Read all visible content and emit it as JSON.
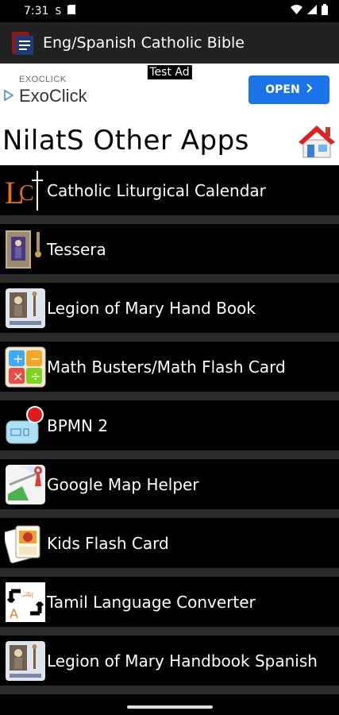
{
  "status_bar": {
    "time": "7:31",
    "icons": [
      "s-icon",
      "sim-card-icon",
      "wifi-icon",
      "signal-icon",
      "battery-icon"
    ]
  },
  "app_bar": {
    "title": "Eng/Spanish Catholic Bible"
  },
  "ad": {
    "badge": "Test Ad",
    "brand_small": "EXOCLICK",
    "brand_big": "ExoClick",
    "cta": "OPEN",
    "cta_color": "#1a73e8"
  },
  "header": {
    "title": "NilatS Other Apps"
  },
  "apps": [
    {
      "label": "Catholic Liturgical Calendar",
      "icon": "lc-cross-icon"
    },
    {
      "label": "Tessera",
      "icon": "tessera-icon"
    },
    {
      "label": "Legion of Mary Hand Book",
      "icon": "legion-icon"
    },
    {
      "label": "Math Busters/Math Flash Card",
      "icon": "math-icon"
    },
    {
      "label": "BPMN 2",
      "icon": "bpmn-icon"
    },
    {
      "label": "Google Map Helper",
      "icon": "map-icon"
    },
    {
      "label": "Kids Flash Card",
      "icon": "kids-cards-icon"
    },
    {
      "label": "Tamil Language Converter",
      "icon": "tamil-converter-icon"
    },
    {
      "label": "Legion of Mary Handbook Spanish",
      "icon": "legion-icon"
    }
  ]
}
